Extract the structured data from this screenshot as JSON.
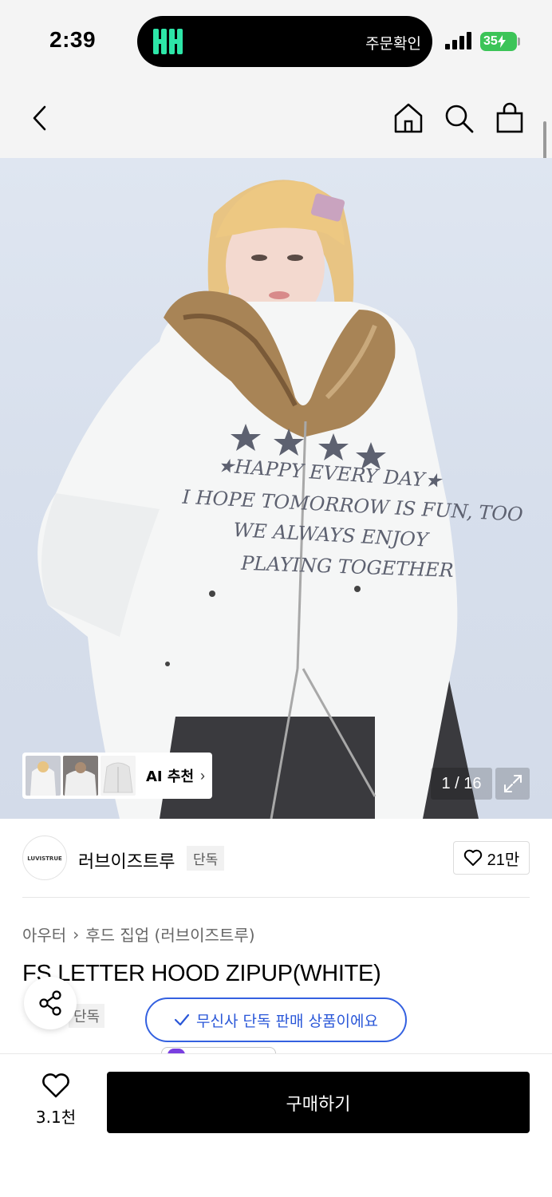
{
  "status_bar": {
    "time": "2:39",
    "live_activity_text": "주문확인",
    "battery": "35"
  },
  "header": {
    "back_icon": "chevron-left-icon",
    "home_icon": "home-icon",
    "search_icon": "search-icon",
    "cart_icon": "shopping-bag-icon"
  },
  "hero": {
    "print_lines": [
      "★HAPPY EVERY DAY★",
      "I HOPE TOMORROW IS FUN, TOO",
      "WE ALWAYS ENJOY",
      "PLAYING TOGETHER"
    ],
    "ai_recommend_label": "AI 추천",
    "ai_recommend_chevron": "›",
    "pager": "1 / 16"
  },
  "brand": {
    "logo_text": "LUVISTRUE",
    "name": "러브이즈트루",
    "exclusive_tag": "단독",
    "likes": "21만"
  },
  "breadcrumb": {
    "category": "아우터",
    "separator": "›",
    "subcategory": "후드 집업 (러브이즈트루)"
  },
  "product": {
    "title": "FS LETTER HOOD ZIPUP(WHITE)",
    "tag": "단독",
    "exclusive_notice": "무신사 단독 판매 상품이에요"
  },
  "bottom_bar": {
    "wish_count": "3.1천",
    "buy_label": "구매하기"
  },
  "colors": {
    "accent_blue": "#3461e0",
    "buy_button": "#000000",
    "battery_green": "#3cc458",
    "app_logo_green": "#2de6a8"
  }
}
